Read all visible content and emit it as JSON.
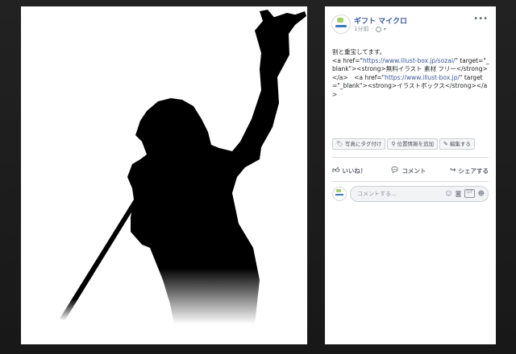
{
  "post": {
    "page_name": "ギフト マイクロ",
    "time": "1分前",
    "body_line1": "割と重宝してます。",
    "body_a1_open": "<a href=\"",
    "body_url1": "https://www.illust-box.jp/sozai/",
    "body_a1_mid": "\" target=\"_blank\"><strong>無料イラスト 素材 フリー</strong></a>　<a href=\"",
    "body_url2": "https://www.illust-box.jp/",
    "body_a2_close": "\" target=\"_blank\"><strong>イラストボックス</strong></a>"
  },
  "tag_bar": {
    "tag_photo": "写真にタグ付け",
    "add_location": "位置情報を追加",
    "edit": "編集する"
  },
  "actions": {
    "like": "いいね！",
    "comment": "コメント",
    "share": "シェアする"
  },
  "comment_box": {
    "placeholder": "コメントする..."
  },
  "icons": {
    "more": "more-options-icon",
    "privacy": "globe-icon",
    "like": "thumbs-up-icon",
    "comment": "comment-bubble-icon",
    "share": "share-arrow-icon",
    "emoji": "emoji-icon",
    "camera": "camera-icon",
    "gif": "gif-icon",
    "sticker": "sticker-icon"
  },
  "colors": {
    "link": "#385898",
    "backdrop": "#1b1b1c"
  }
}
